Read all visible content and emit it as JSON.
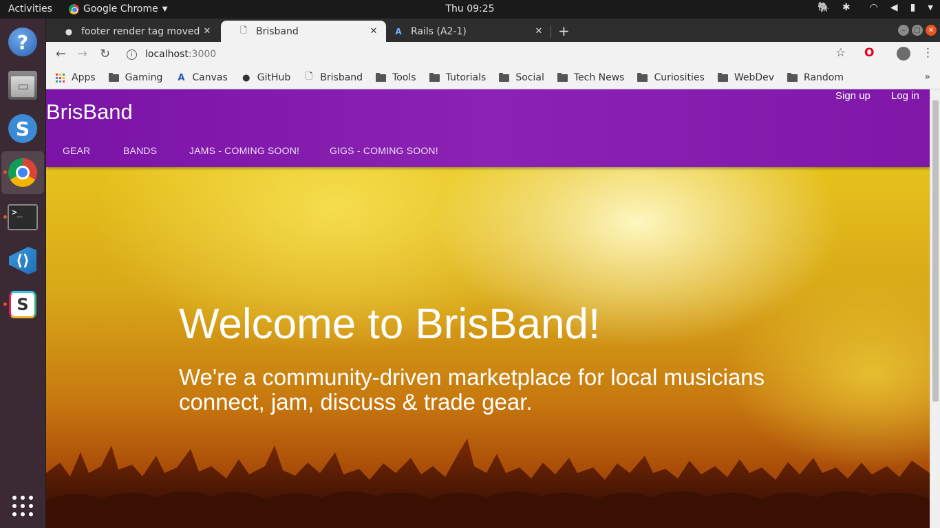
{
  "topbar": {
    "activities": "Activities",
    "app_name": "Google Chrome",
    "clock": "Thu 09:25"
  },
  "dock": {
    "items": [
      "help-icon",
      "files-icon",
      "simplenote-icon",
      "chrome-icon",
      "terminal-icon",
      "vscode-icon",
      "slack-icon",
      "show-apps-icon"
    ],
    "terminal_glyph": ">_",
    "simplenote_glyph": "S",
    "slack_glyph": "S",
    "help_glyph": "?"
  },
  "browser": {
    "tabs": [
      {
        "title": "footer render tag moved",
        "favicon": "github-icon"
      },
      {
        "title": "Brisband",
        "favicon": "page-icon"
      },
      {
        "title": "Rails (A2-1)",
        "favicon": "canvas-icon"
      }
    ],
    "url_host": "localhost",
    "url_port": ":3000",
    "bookmarks": [
      {
        "label": "Apps",
        "icon": "apps-icon"
      },
      {
        "label": "Gaming",
        "icon": "folder-icon"
      },
      {
        "label": "Canvas",
        "icon": "canvas-icon"
      },
      {
        "label": "GitHub",
        "icon": "github-icon"
      },
      {
        "label": "Brisband",
        "icon": "page-icon"
      },
      {
        "label": "Tools",
        "icon": "folder-icon"
      },
      {
        "label": "Tutorials",
        "icon": "folder-icon"
      },
      {
        "label": "Social",
        "icon": "folder-icon"
      },
      {
        "label": "Tech News",
        "icon": "folder-icon"
      },
      {
        "label": "Curiosities",
        "icon": "folder-icon"
      },
      {
        "label": "WebDev",
        "icon": "folder-icon"
      },
      {
        "label": "Random",
        "icon": "folder-icon"
      }
    ]
  },
  "site": {
    "brand": "BrisBand",
    "auth": {
      "signup": "Sign up",
      "login": "Log in"
    },
    "menu": [
      "GEAR",
      "BANDS",
      "JAMS - COMING SOON!",
      "GIGS - COMING SOON!"
    ],
    "hero": {
      "title": "Welcome to BrisBand!",
      "subtitle": "We're a community-driven marketplace for local musicians connect, jam, discuss & trade gear."
    }
  },
  "colors": {
    "nav_purple": "#8b22b4",
    "hero_yellow": "#e6c21c",
    "dock_bg": "#3b2a33",
    "ubuntu_orange": "#e95420"
  }
}
